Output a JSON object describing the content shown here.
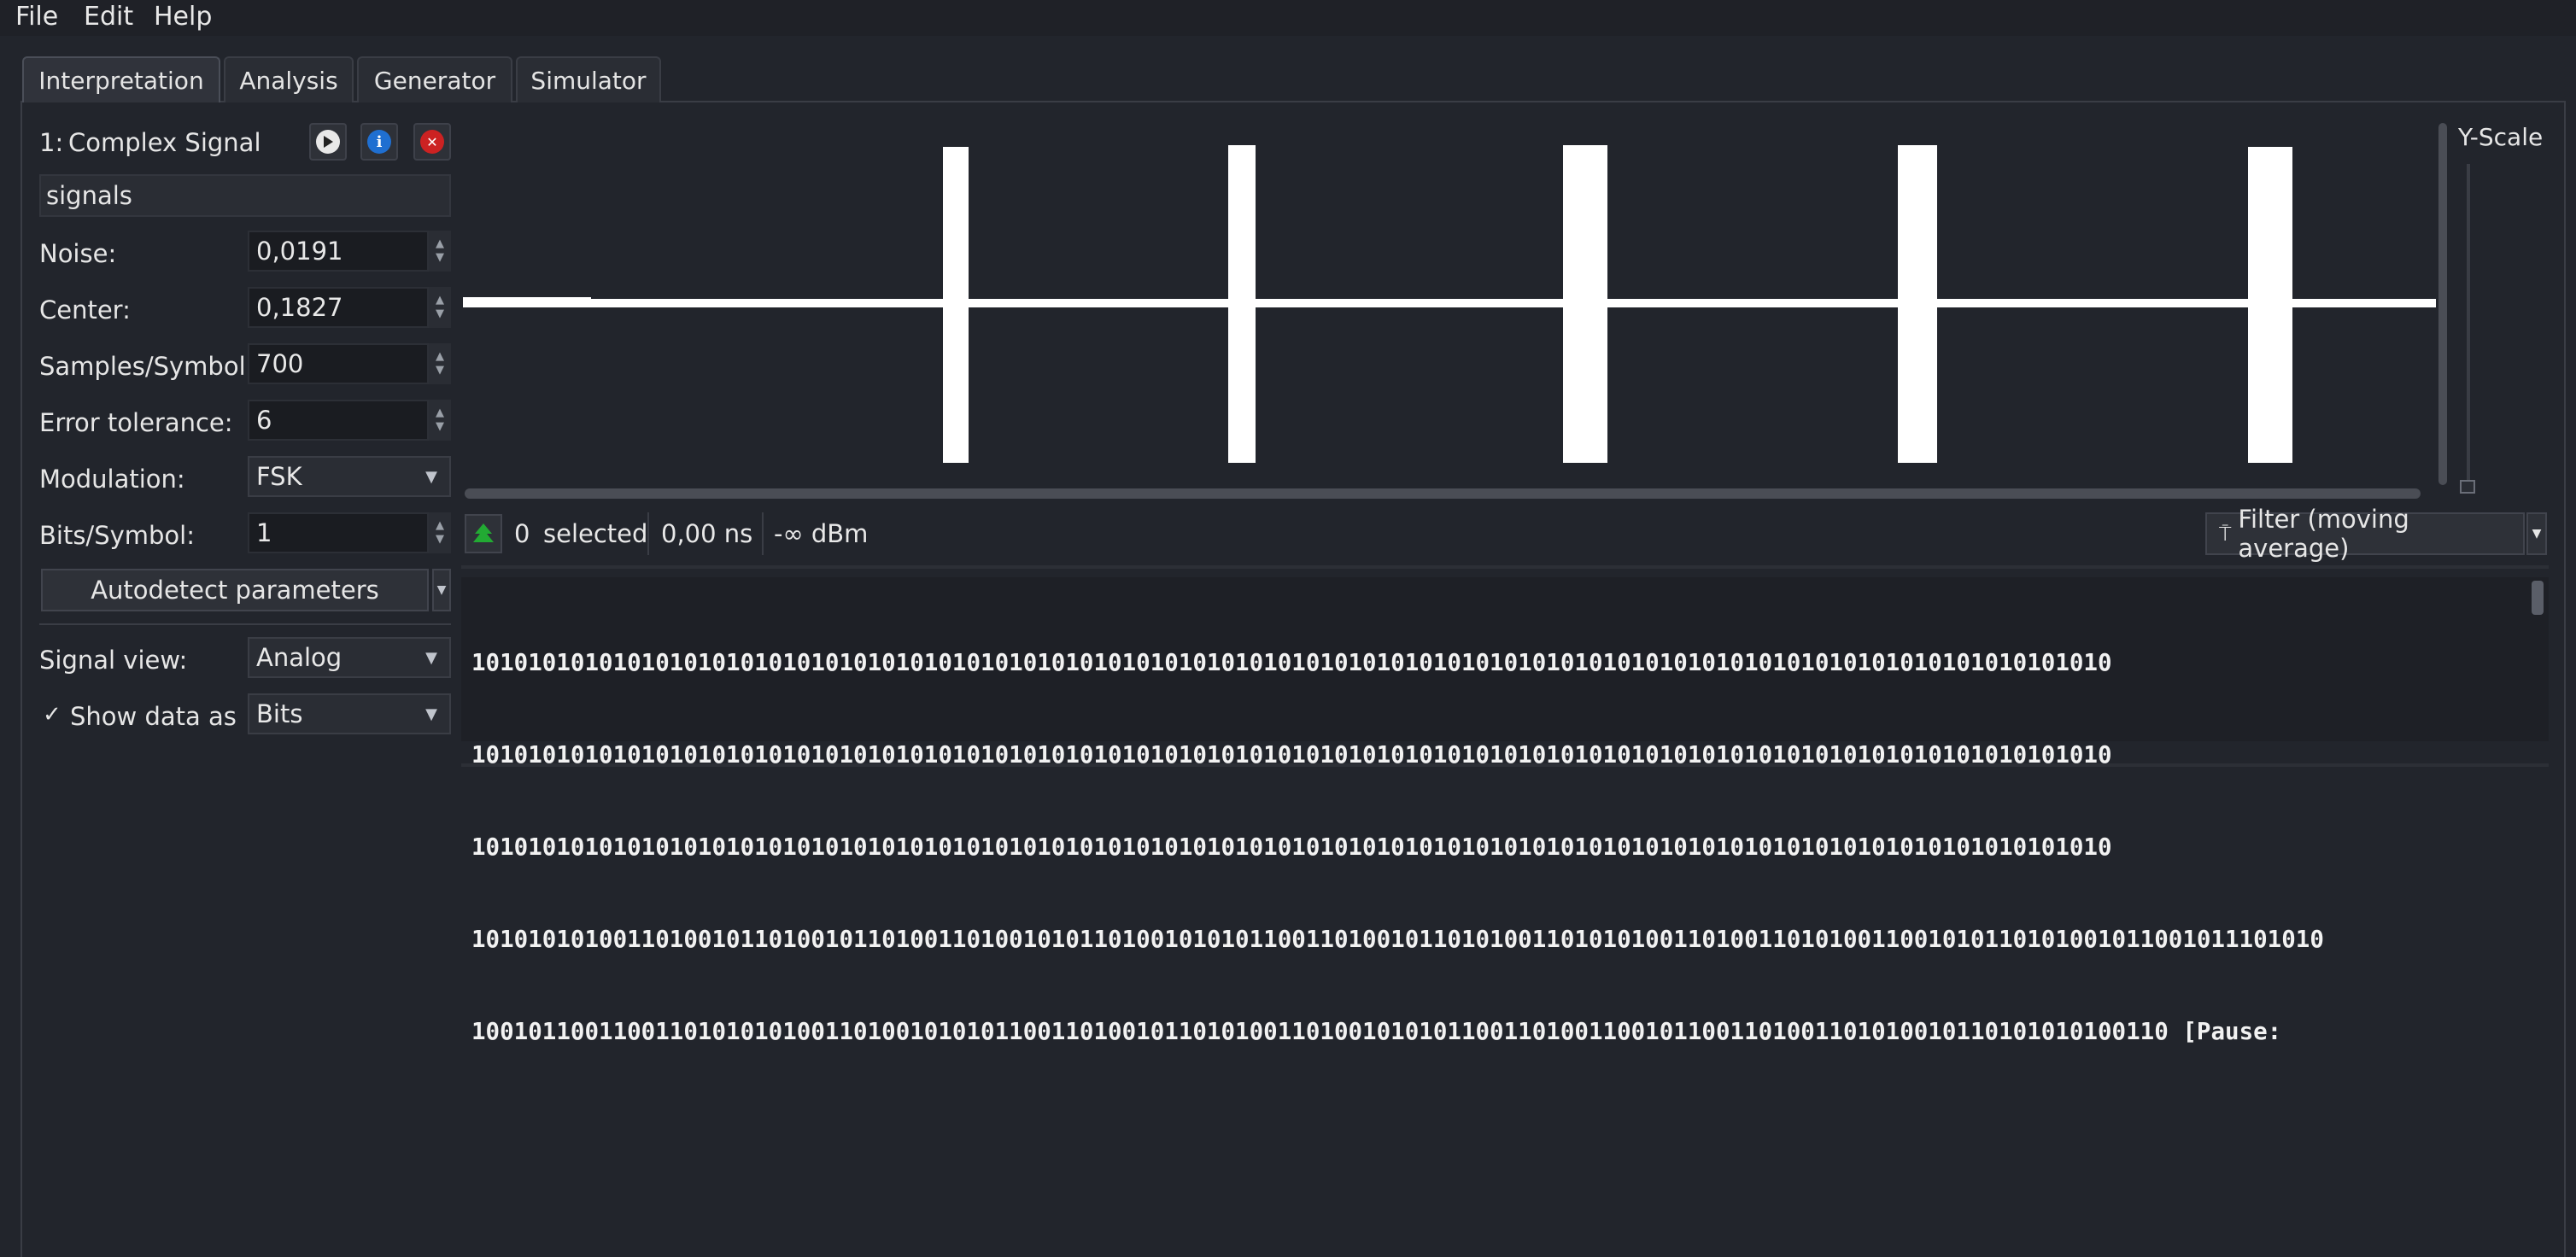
{
  "menu": [
    "File",
    "Edit",
    "Help"
  ],
  "tabs": [
    "Interpretation",
    "Analysis",
    "Generator",
    "Simulator"
  ],
  "signal": {
    "index_label": "1:",
    "title": "Complex Signal",
    "name_value": "signals"
  },
  "params": {
    "noise_label": "Noise:",
    "noise_value": "0,0191",
    "center_label": "Center:",
    "center_value": "0,1827",
    "sps_label": "Samples/Symbol:",
    "sps_value": "700",
    "err_label": "Error tolerance:",
    "err_value": "6",
    "mod_label": "Modulation:",
    "mod_value": "FSK",
    "bps_label": "Bits/Symbol:",
    "bps_value": "1",
    "autodetect_label": "Autodetect parameters",
    "view_label": "Signal view:",
    "view_value": "Analog",
    "showdata_label": "Show data as",
    "showdata_checked": "✓",
    "showdata_value": "Bits"
  },
  "plot": {
    "yscale_label": "Y-Scale"
  },
  "status": {
    "selected_count": "0",
    "selected_label": "selected",
    "duration": "0,00 ns",
    "power": "-∞ dBm",
    "filter_label": "Filter (moving average)"
  },
  "bits_lines": [
    "10101010101010101010101010101010101010101010101010101010101010101010101010101010101010101010101010101010101010101010",
    "10101010101010101010101010101010101010101010101010101010101010101010101010101010101010101010101010101010101010101010",
    "10101010101010101010101010101010101010101010101010101010101010101010101010101010101010101010101010101010101010101010",
    "10101010100110100101101001011010011010010101101001010101100110100101101010011010101001101001101010011001010110101001011001011101010",
    "100101100110011010101010011010010101011001101001011010100110100101010110011010011001011001101001101010010110101010100110",
    "[Pause:"
  ],
  "icons": {
    "play": "play-icon",
    "info": "info-icon",
    "close": "close-icon",
    "filter": "filter-icon"
  },
  "colors": {
    "background": "#22252c",
    "signal": "#ffffff",
    "close_red": "#cc2222",
    "info_blue": "#1f6fd1",
    "green": "#22aa33"
  }
}
